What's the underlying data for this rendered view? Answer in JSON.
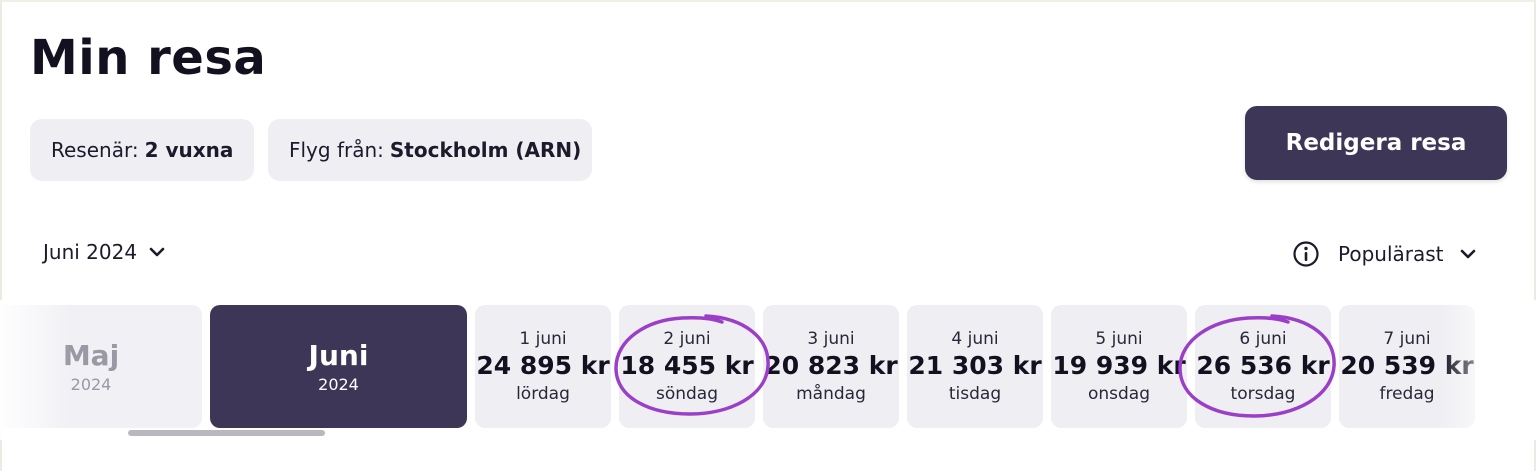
{
  "title": "Min resa",
  "travellers": {
    "label": "Resenär:",
    "value": "2 vuxna"
  },
  "departure": {
    "label": "Flyg från:",
    "value": "Stockholm (ARN)"
  },
  "edit_button": "Redigera resa",
  "month_selector": {
    "label": "Juni 2024",
    "icon": "chevron-down-icon"
  },
  "sort_selector": {
    "label": "Populärast",
    "icon": "chevron-down-icon",
    "info_icon": "info-icon"
  },
  "months": [
    {
      "name": "Maj",
      "year": "2024",
      "selected": false
    },
    {
      "name": "Juni",
      "year": "2024",
      "selected": true
    }
  ],
  "days": [
    {
      "date": "1 juni",
      "price": "24 895 kr",
      "weekday": "lördag",
      "highlighted": false
    },
    {
      "date": "2 juni",
      "price": "18 455 kr",
      "weekday": "söndag",
      "highlighted": true
    },
    {
      "date": "3 juni",
      "price": "20 823 kr",
      "weekday": "måndag",
      "highlighted": false
    },
    {
      "date": "4 juni",
      "price": "21 303 kr",
      "weekday": "tisdag",
      "highlighted": false
    },
    {
      "date": "5 juni",
      "price": "19 939 kr",
      "weekday": "onsdag",
      "highlighted": false
    },
    {
      "date": "6 juni",
      "price": "26 536 kr",
      "weekday": "torsdag",
      "highlighted": true
    },
    {
      "date": "7 juni",
      "price": "20 539 kr",
      "weekday": "fredag",
      "highlighted": false
    }
  ],
  "colors": {
    "accent": "#3e3656",
    "chip_bg": "#efeef3",
    "highlight_circle": "#9b3fc8"
  }
}
